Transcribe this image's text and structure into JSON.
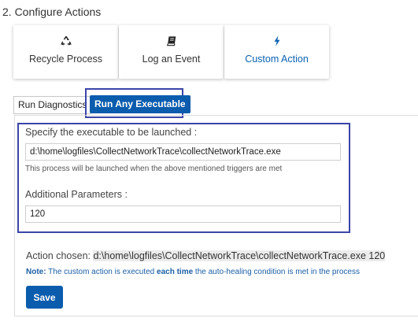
{
  "section_title": "2. Configure Actions",
  "action_cards": [
    {
      "label": "Recycle Process",
      "icon": "recycle-icon"
    },
    {
      "label": "Log an Event",
      "icon": "book-icon"
    },
    {
      "label": "Custom Action",
      "icon": "bolt-icon",
      "selected": true
    }
  ],
  "tabs": [
    {
      "label": "Run Diagnostics"
    },
    {
      "label": "Run Any Executable",
      "active": true
    }
  ],
  "form": {
    "executable_label": "Specify the executable to be launched :",
    "executable_value": "d:\\home\\logfiles\\CollectNetworkTrace\\collectNetworkTrace.exe",
    "executable_hint": "This process will be launched when the above mentioned triggers are met",
    "params_label": "Additional Parameters :",
    "params_value": "120"
  },
  "action_chosen": {
    "prefix": "Action chosen: ",
    "value": "d:\\home\\logfiles\\CollectNetworkTrace\\collectNetworkTrace.exe 120"
  },
  "note": {
    "label": "Note:",
    "part1": " The custom action is executed ",
    "emphasis": "each time",
    "part2": " the auto-healing condition is met in the process"
  },
  "save_label": "Save",
  "colors": {
    "accent": "#0b5cad",
    "highlight_border": "#3b45a8",
    "note_text": "#1b5fa6"
  }
}
